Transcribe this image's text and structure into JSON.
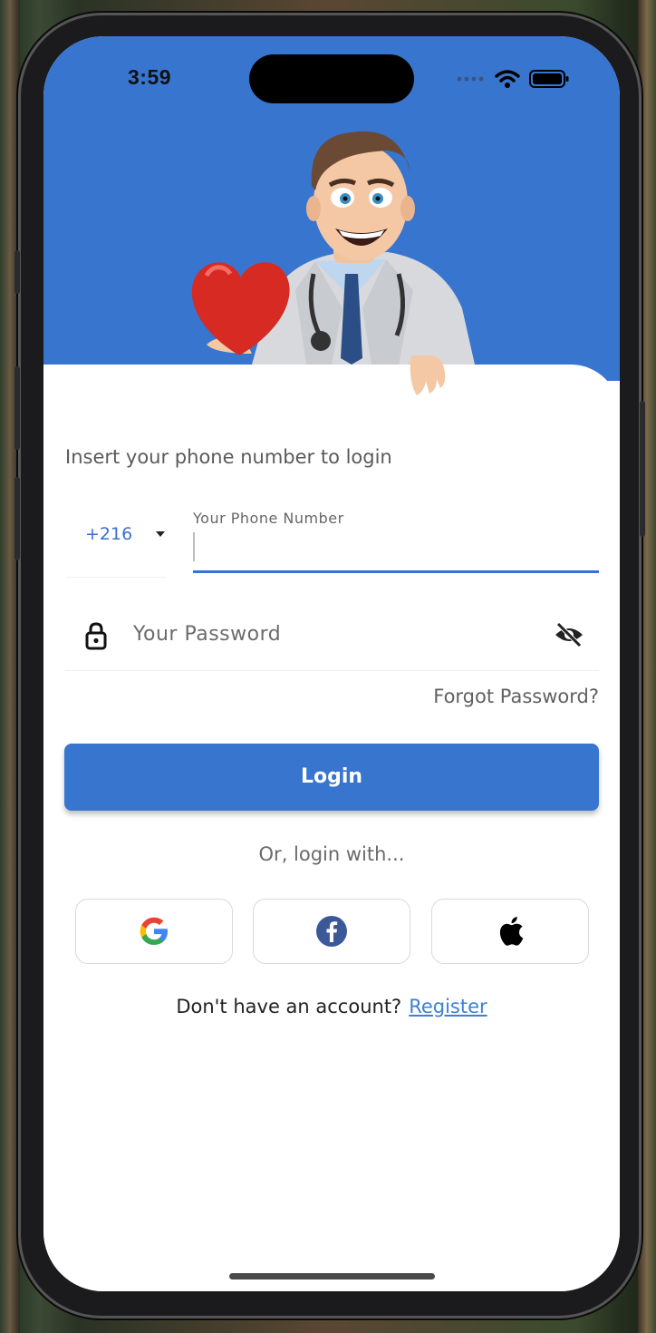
{
  "status_bar": {
    "time": "3:59"
  },
  "login": {
    "prompt": "Insert your phone number to login",
    "country_code": "+216",
    "phone_label": "Your Phone Number",
    "phone_value": "",
    "password_placeholder": "Your Password",
    "forgot_password": "Forgot Password?",
    "login_button": "Login",
    "or_text": "Or, login with...",
    "no_account_text": "Don't have an account?",
    "register_link": "Register"
  },
  "social": [
    {
      "name": "google",
      "icon": "google-icon"
    },
    {
      "name": "facebook",
      "icon": "facebook-icon"
    },
    {
      "name": "apple",
      "icon": "apple-icon"
    }
  ],
  "colors": {
    "primary": "#3875cf",
    "link": "#3a80d6",
    "underline": "#3a6fd8",
    "facebook": "#3b5998"
  }
}
